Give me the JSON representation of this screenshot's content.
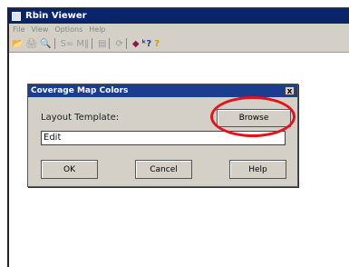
{
  "app": {
    "title": "Rbin Viewer",
    "menu": [
      "File",
      "View",
      "Options",
      "Help"
    ],
    "toolbar": {
      "open": "📂",
      "print": "🖨",
      "preview": "🔍",
      "sort": "S=",
      "bars": "M‖",
      "save": "▤",
      "refresh": "⟳",
      "map": "◆",
      "whats_this": "ᵏ?",
      "help": "?"
    }
  },
  "dialog": {
    "title": "Coverage Map Colors",
    "close": "x",
    "layout_label": "Layout Template:",
    "browse_label": "Browse",
    "template_value": "Edit",
    "ok_label": "OK",
    "cancel_label": "Cancel",
    "help_label": "Help"
  },
  "colors": {
    "titlebar": "#0a246a",
    "dialog_title": "#1a3d8f",
    "highlight_ring": "#e8101a"
  }
}
